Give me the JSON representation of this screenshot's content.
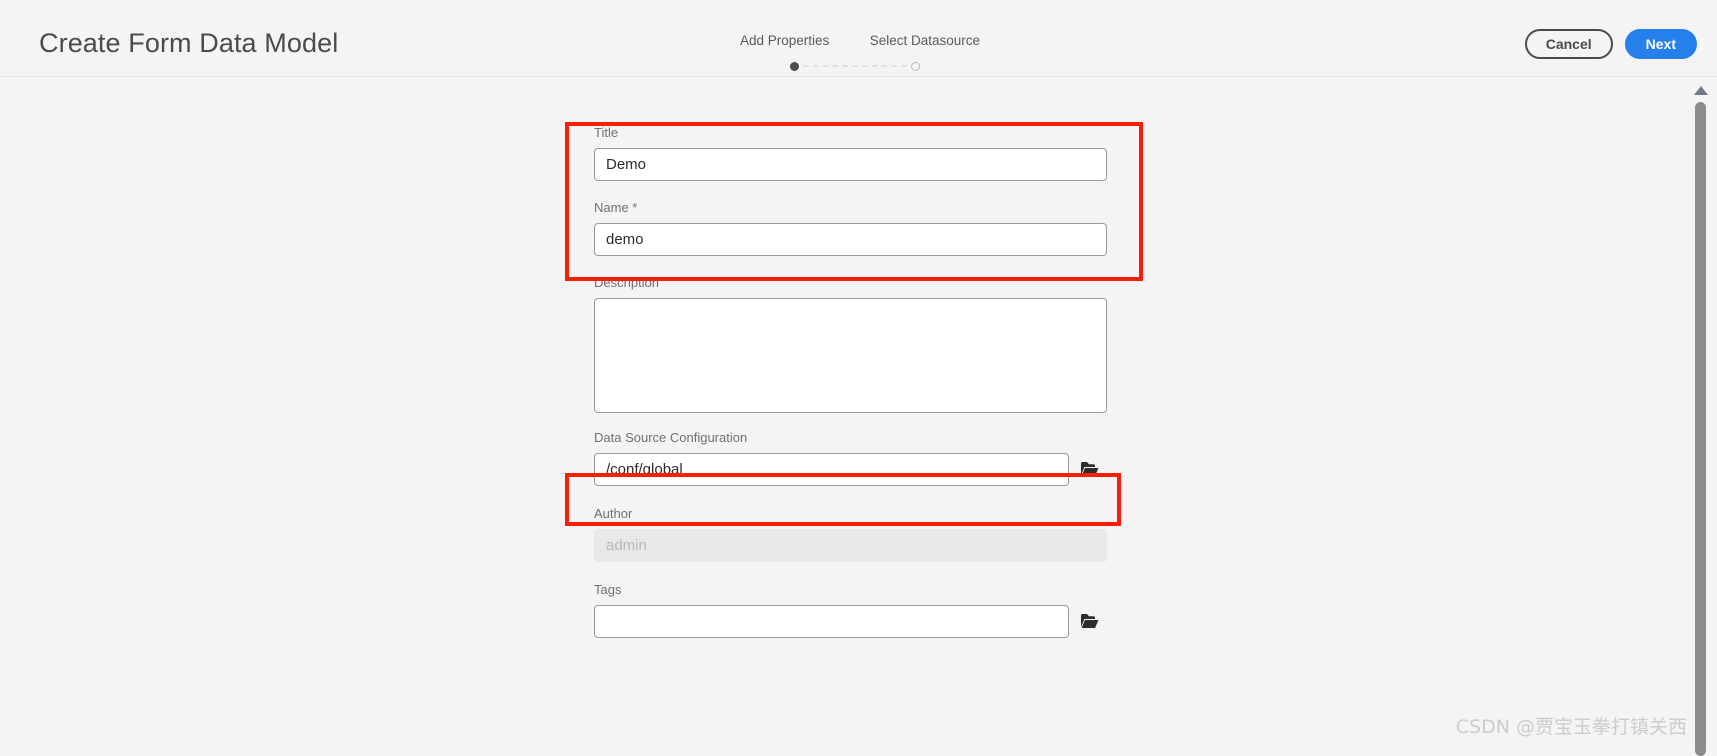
{
  "header": {
    "title": "Create Form Data Model",
    "cancel_label": "Cancel",
    "next_label": "Next"
  },
  "steps": {
    "items": [
      {
        "label": "Add Properties",
        "state": "active"
      },
      {
        "label": "Select Datasource",
        "state": "inactive"
      }
    ]
  },
  "form": {
    "title": {
      "label": "Title",
      "value": "Demo",
      "placeholder": ""
    },
    "name": {
      "label": "Name *",
      "value": "demo",
      "placeholder": ""
    },
    "description": {
      "label": "Description",
      "value": "",
      "placeholder": ""
    },
    "data_source_configuration": {
      "label": "Data Source Configuration",
      "value": "/conf/global",
      "placeholder": "",
      "browse_icon": "folder-icon"
    },
    "author": {
      "label": "Author",
      "value": "admin",
      "placeholder": "admin",
      "disabled": true
    },
    "tags": {
      "label": "Tags",
      "value": "",
      "placeholder": "",
      "browse_icon": "folder-icon"
    }
  },
  "scrollbar": {
    "up_arrow_icon": "triangle-up-icon"
  },
  "watermark": {
    "text": "CSDN @贾宝玉拳打镇关西"
  },
  "colors": {
    "accent": "#2680eb",
    "annotation": "#f91f06",
    "background": "#f4f4f4"
  }
}
